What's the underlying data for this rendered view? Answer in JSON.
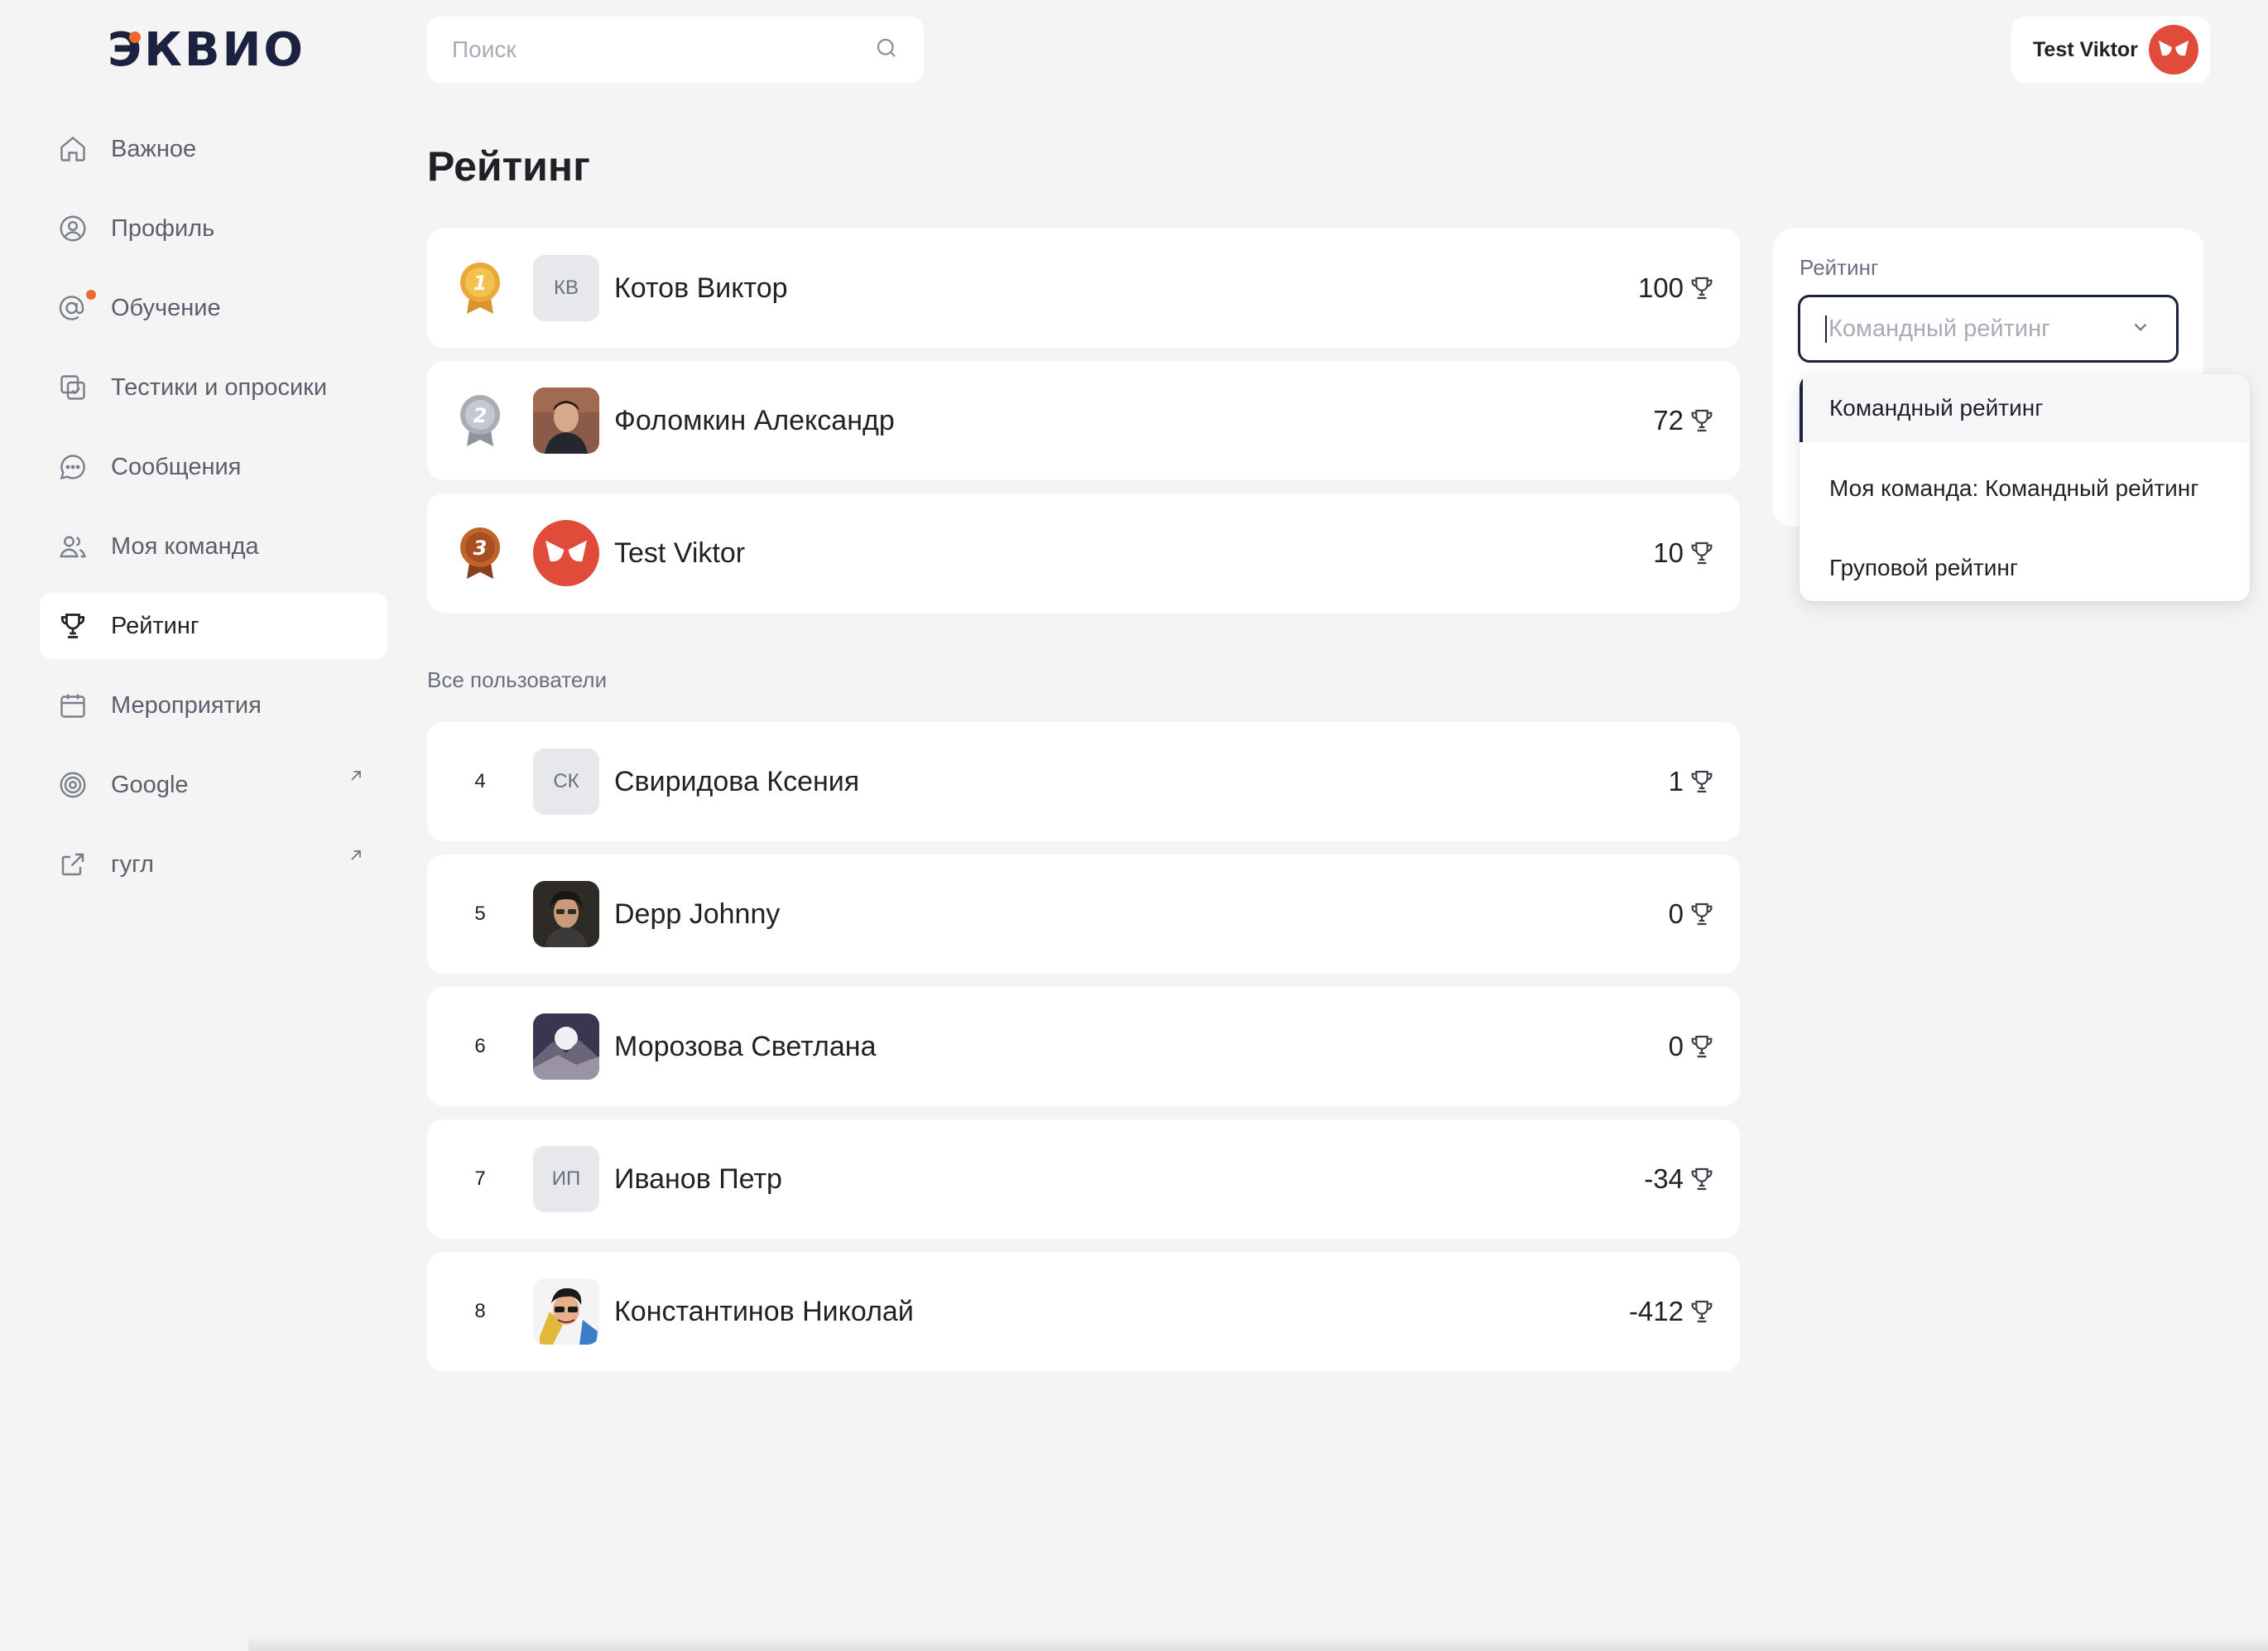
{
  "logo": {
    "text": "ЭКВИО"
  },
  "sidebar": {
    "items": [
      {
        "label": "Важное",
        "icon": "home-icon"
      },
      {
        "label": "Профиль",
        "icon": "profile-icon"
      },
      {
        "label": "Обучение",
        "icon": "learning-icon",
        "notification": true
      },
      {
        "label": "Тестики и опросики",
        "icon": "tests-icon"
      },
      {
        "label": "Сообщения",
        "icon": "messages-icon"
      },
      {
        "label": "Моя команда",
        "icon": "team-icon"
      },
      {
        "label": "Рейтинг",
        "icon": "trophy-icon",
        "active": true
      },
      {
        "label": "Мероприятия",
        "icon": "calendar-icon"
      },
      {
        "label": "Google",
        "icon": "target-icon",
        "external": true
      },
      {
        "label": "гугл",
        "icon": "external-link-icon",
        "external": true
      }
    ]
  },
  "search": {
    "placeholder": "Поиск"
  },
  "user": {
    "name": "Test Viktor"
  },
  "page": {
    "title": "Рейтинг"
  },
  "top3": [
    {
      "rank": "1",
      "initials": "КВ",
      "name": "Котов Виктор",
      "score": "100",
      "medal_color": "#e8a93a"
    },
    {
      "rank": "2",
      "initials": "",
      "name": "Фоломкин Александр",
      "score": "72",
      "medal_color": "#a9adb8"
    },
    {
      "rank": "3",
      "initials": "",
      "name": "Test Viktor",
      "score": "10",
      "medal_color": "#c0642a"
    }
  ],
  "all_users_label": "Все пользователи",
  "users": [
    {
      "rank": "4",
      "initials": "СК",
      "name": "Свиридова Ксения",
      "score": "1"
    },
    {
      "rank": "5",
      "initials": "",
      "name": "Depp Johnny",
      "score": "0"
    },
    {
      "rank": "6",
      "initials": "",
      "name": "Морозова Светлана",
      "score": "0"
    },
    {
      "rank": "7",
      "initials": "ИП",
      "name": "Иванов Петр",
      "score": "-34"
    },
    {
      "rank": "8",
      "initials": "",
      "name": "Константинов Николай",
      "score": "-412"
    }
  ],
  "rating_panel": {
    "label": "Рейтинг",
    "select_placeholder": "Командный рейтинг",
    "options": [
      "Командный рейтинг",
      "Моя команда: Командный рейтинг",
      "Груповой рейтинг"
    ],
    "selected_index": 0
  },
  "colors": {
    "accent": "#1b2240",
    "logo_dot": "#ee6a2c",
    "avatar_red": "#e04b3a"
  }
}
